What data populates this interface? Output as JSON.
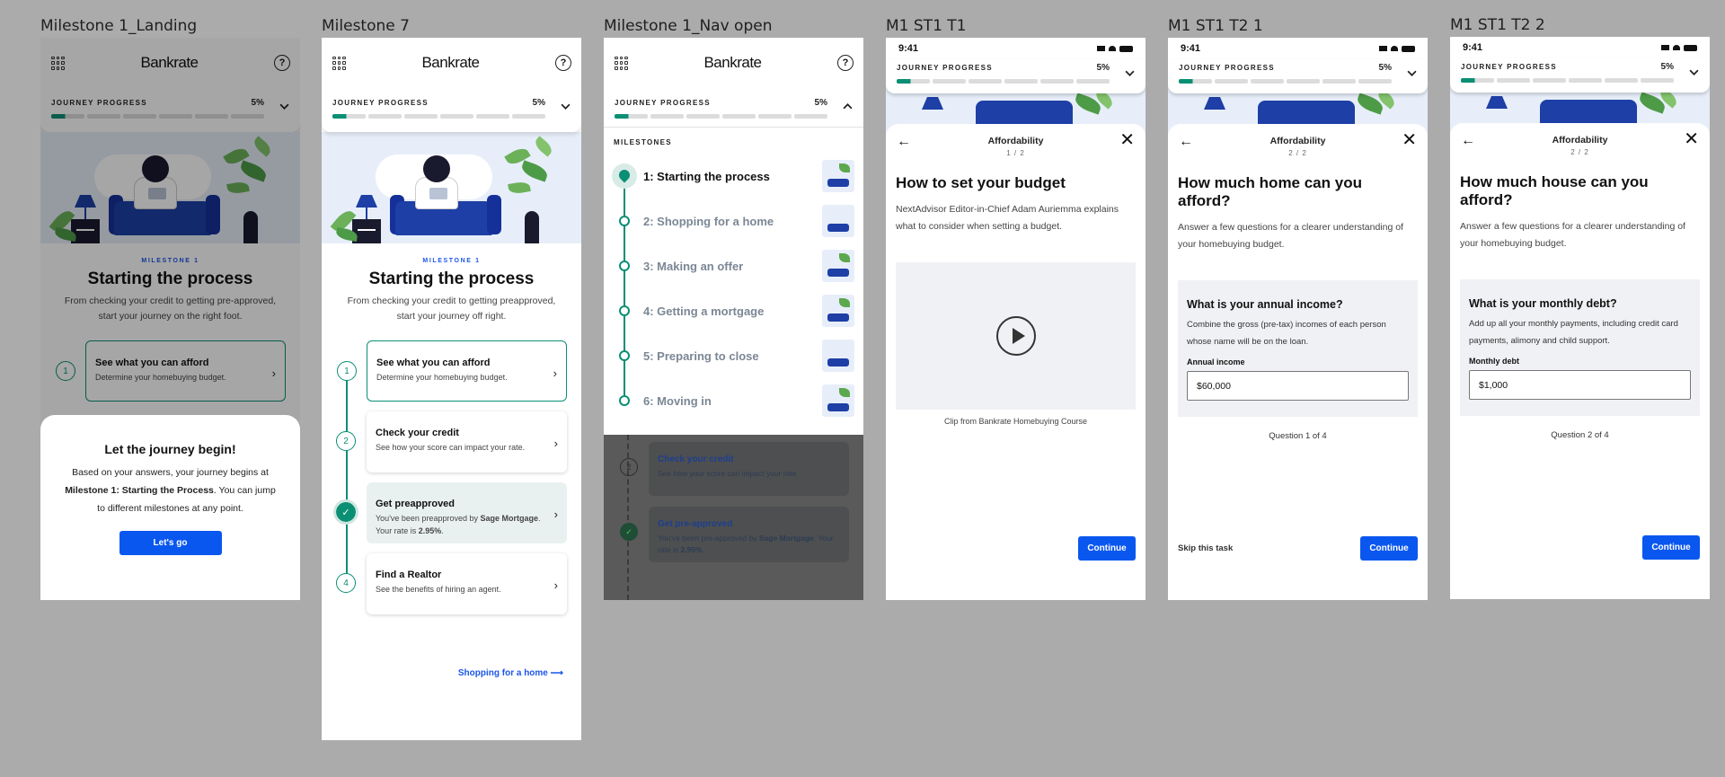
{
  "frames": {
    "f1": {
      "label": "Milestone 1_Landing"
    },
    "f2": {
      "label": "Milestone 7"
    },
    "f3": {
      "label": "Milestone 1_Nav open"
    },
    "f4": {
      "label": "M1 ST1 T1"
    },
    "f5": {
      "label": "M1 ST1 T2 1"
    },
    "f6": {
      "label": "M1 ST1 T2 2"
    }
  },
  "brand": {
    "logo": "Bankrate",
    "help": "?",
    "accent": "#0a57f0",
    "success": "#0a8f74"
  },
  "progress": {
    "label": "JOURNEY PROGRESS",
    "percent": "5%",
    "fraction": 0.05
  },
  "milestone": {
    "eyebrow": "MILESTONE 1",
    "title": "Starting the process",
    "desc_f1": "From checking your credit to getting pre-approved, start your journey on the right foot.",
    "desc_f2": "From checking your credit to getting preapproved, start your journey off right."
  },
  "steps": [
    {
      "num": "1",
      "title": "See what you can afford",
      "desc": "Determine your homebuying budget."
    },
    {
      "num": "2",
      "title": "Check your credit",
      "desc": "See how your score can impact your rate."
    },
    {
      "num": "3",
      "title": "Get preapproved",
      "desc_pre": "You've been preapproved by ",
      "lender": "Sage Mortgage",
      "desc_mid": ". Your rate is ",
      "rate": "2.95%",
      "desc_end": "."
    },
    {
      "num": "4",
      "title": "Find a Realtor",
      "desc": "See the benefits of hiring an agent."
    }
  ],
  "next_link": "Shopping for a home",
  "sheet": {
    "title": "Let the journey begin!",
    "text_pre": "Based on your answers, your journey begins at ",
    "text_bold": "Milestone 1: Starting the Process",
    "text_post": ". You can jump to different milestones at any point.",
    "button": "Let's go"
  },
  "nav": {
    "header": "MILESTONES",
    "items": [
      "1: Starting the process",
      "2: Shopping for a home",
      "3: Making an offer",
      "4: Getting a mortgage",
      "5: Preparing to close",
      "6: Moving in"
    ],
    "dim_step2_title": "Check your credit",
    "dim_step2_desc": "See how your score can impact your rate.",
    "dim_step3_title": "Get pre-approved",
    "dim_step3_pre": "You've been pre-approved by ",
    "dim_step3_lender": "Sage Mortgage",
    "dim_step3_mid": ". Your rate is ",
    "dim_step3_rate": "2.95%",
    "dim_step3_end": "."
  },
  "status": {
    "time": "9:41"
  },
  "task1": {
    "section": "Affordability",
    "counter": "1 / 2",
    "title": "How to set your budget",
    "lead": "NextAdvisor Editor-in-Chief Adam Auriemma explains what to consider when setting a budget.",
    "caption": "Clip from Bankrate Homebuying Course",
    "button": "Continue"
  },
  "task2a": {
    "section": "Affordability",
    "counter": "2 / 2",
    "title": "How much home can you afford?",
    "lead": "Answer a few questions for a clearer understanding of your homebuying budget.",
    "question": "What is your annual income?",
    "help": "Combine the gross (pre-tax) incomes of each person whose name will be on the loan.",
    "field_label": "Annual income",
    "field_value": "$60,000",
    "qcount": "Question 1 of 4",
    "skip": "Skip this task",
    "button": "Continue"
  },
  "task2b": {
    "section": "Affordability",
    "counter": "2 / 2",
    "title": "How much house can you afford?",
    "lead": "Answer a few questions for a clearer understanding of your homebuying budget.",
    "question": "What is your monthly debt?",
    "help": "Add up all your monthly payments, including credit card payments, alimony and child support.",
    "field_label": "Monthly debt",
    "field_value": "$1,000",
    "qcount": "Question 2 of 4",
    "button": "Continue"
  }
}
